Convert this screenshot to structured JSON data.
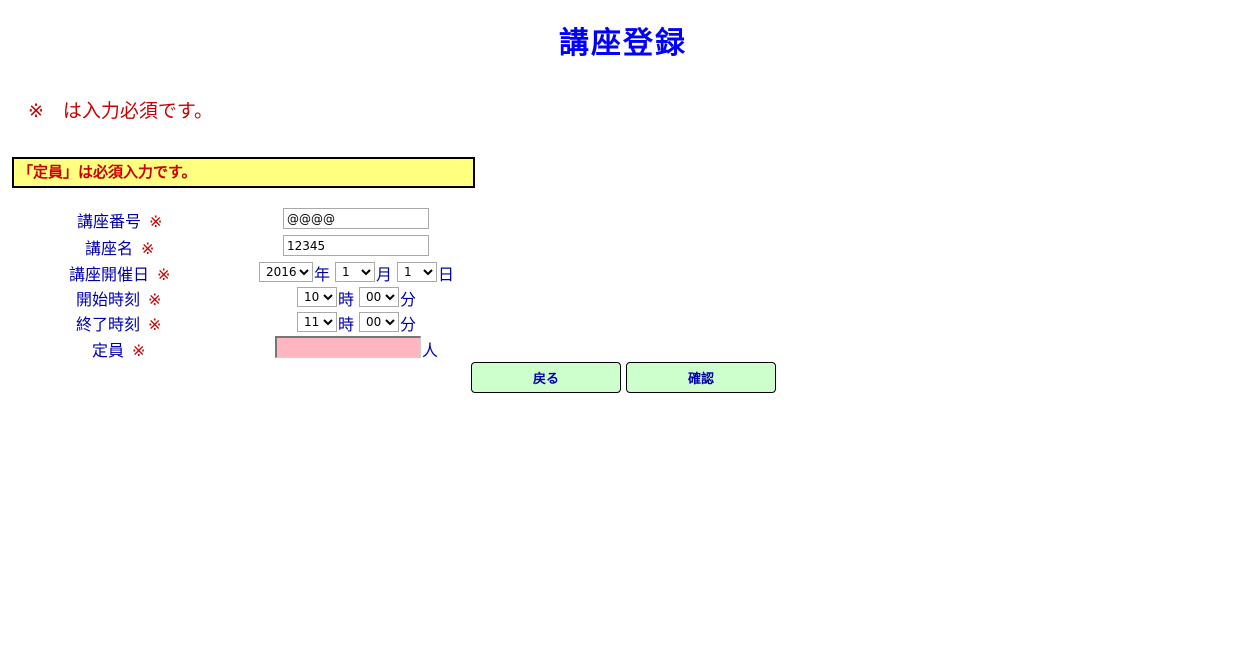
{
  "title": "講座登録",
  "required_note": "※　は入力必須です。",
  "error_message": "「定員」は必須入力です。",
  "required_mark": "※",
  "form": {
    "course_number": {
      "label": "講座番号",
      "value": "@@@@"
    },
    "course_name": {
      "label": "講座名",
      "value": "12345"
    },
    "course_date": {
      "label": "講座開催日",
      "year": "2016",
      "year_unit": "年",
      "month": "1",
      "month_unit": "月",
      "day": "1",
      "day_unit": "日"
    },
    "start_time": {
      "label": "開始時刻",
      "hour": "10",
      "hour_unit": "時",
      "minute": "00",
      "minute_unit": "分"
    },
    "end_time": {
      "label": "終了時刻",
      "hour": "11",
      "hour_unit": "時",
      "minute": "00",
      "minute_unit": "分"
    },
    "capacity": {
      "label": "定員",
      "value": "",
      "unit": "人"
    }
  },
  "buttons": {
    "back": "戻る",
    "confirm": "確認"
  },
  "colors": {
    "title": "#0000ff",
    "label": "#0000aa",
    "required": "#cc0000",
    "error_bg": "#ffff80",
    "button_bg": "#ccffcc",
    "invalid_field_bg": "#ffb6c1"
  }
}
